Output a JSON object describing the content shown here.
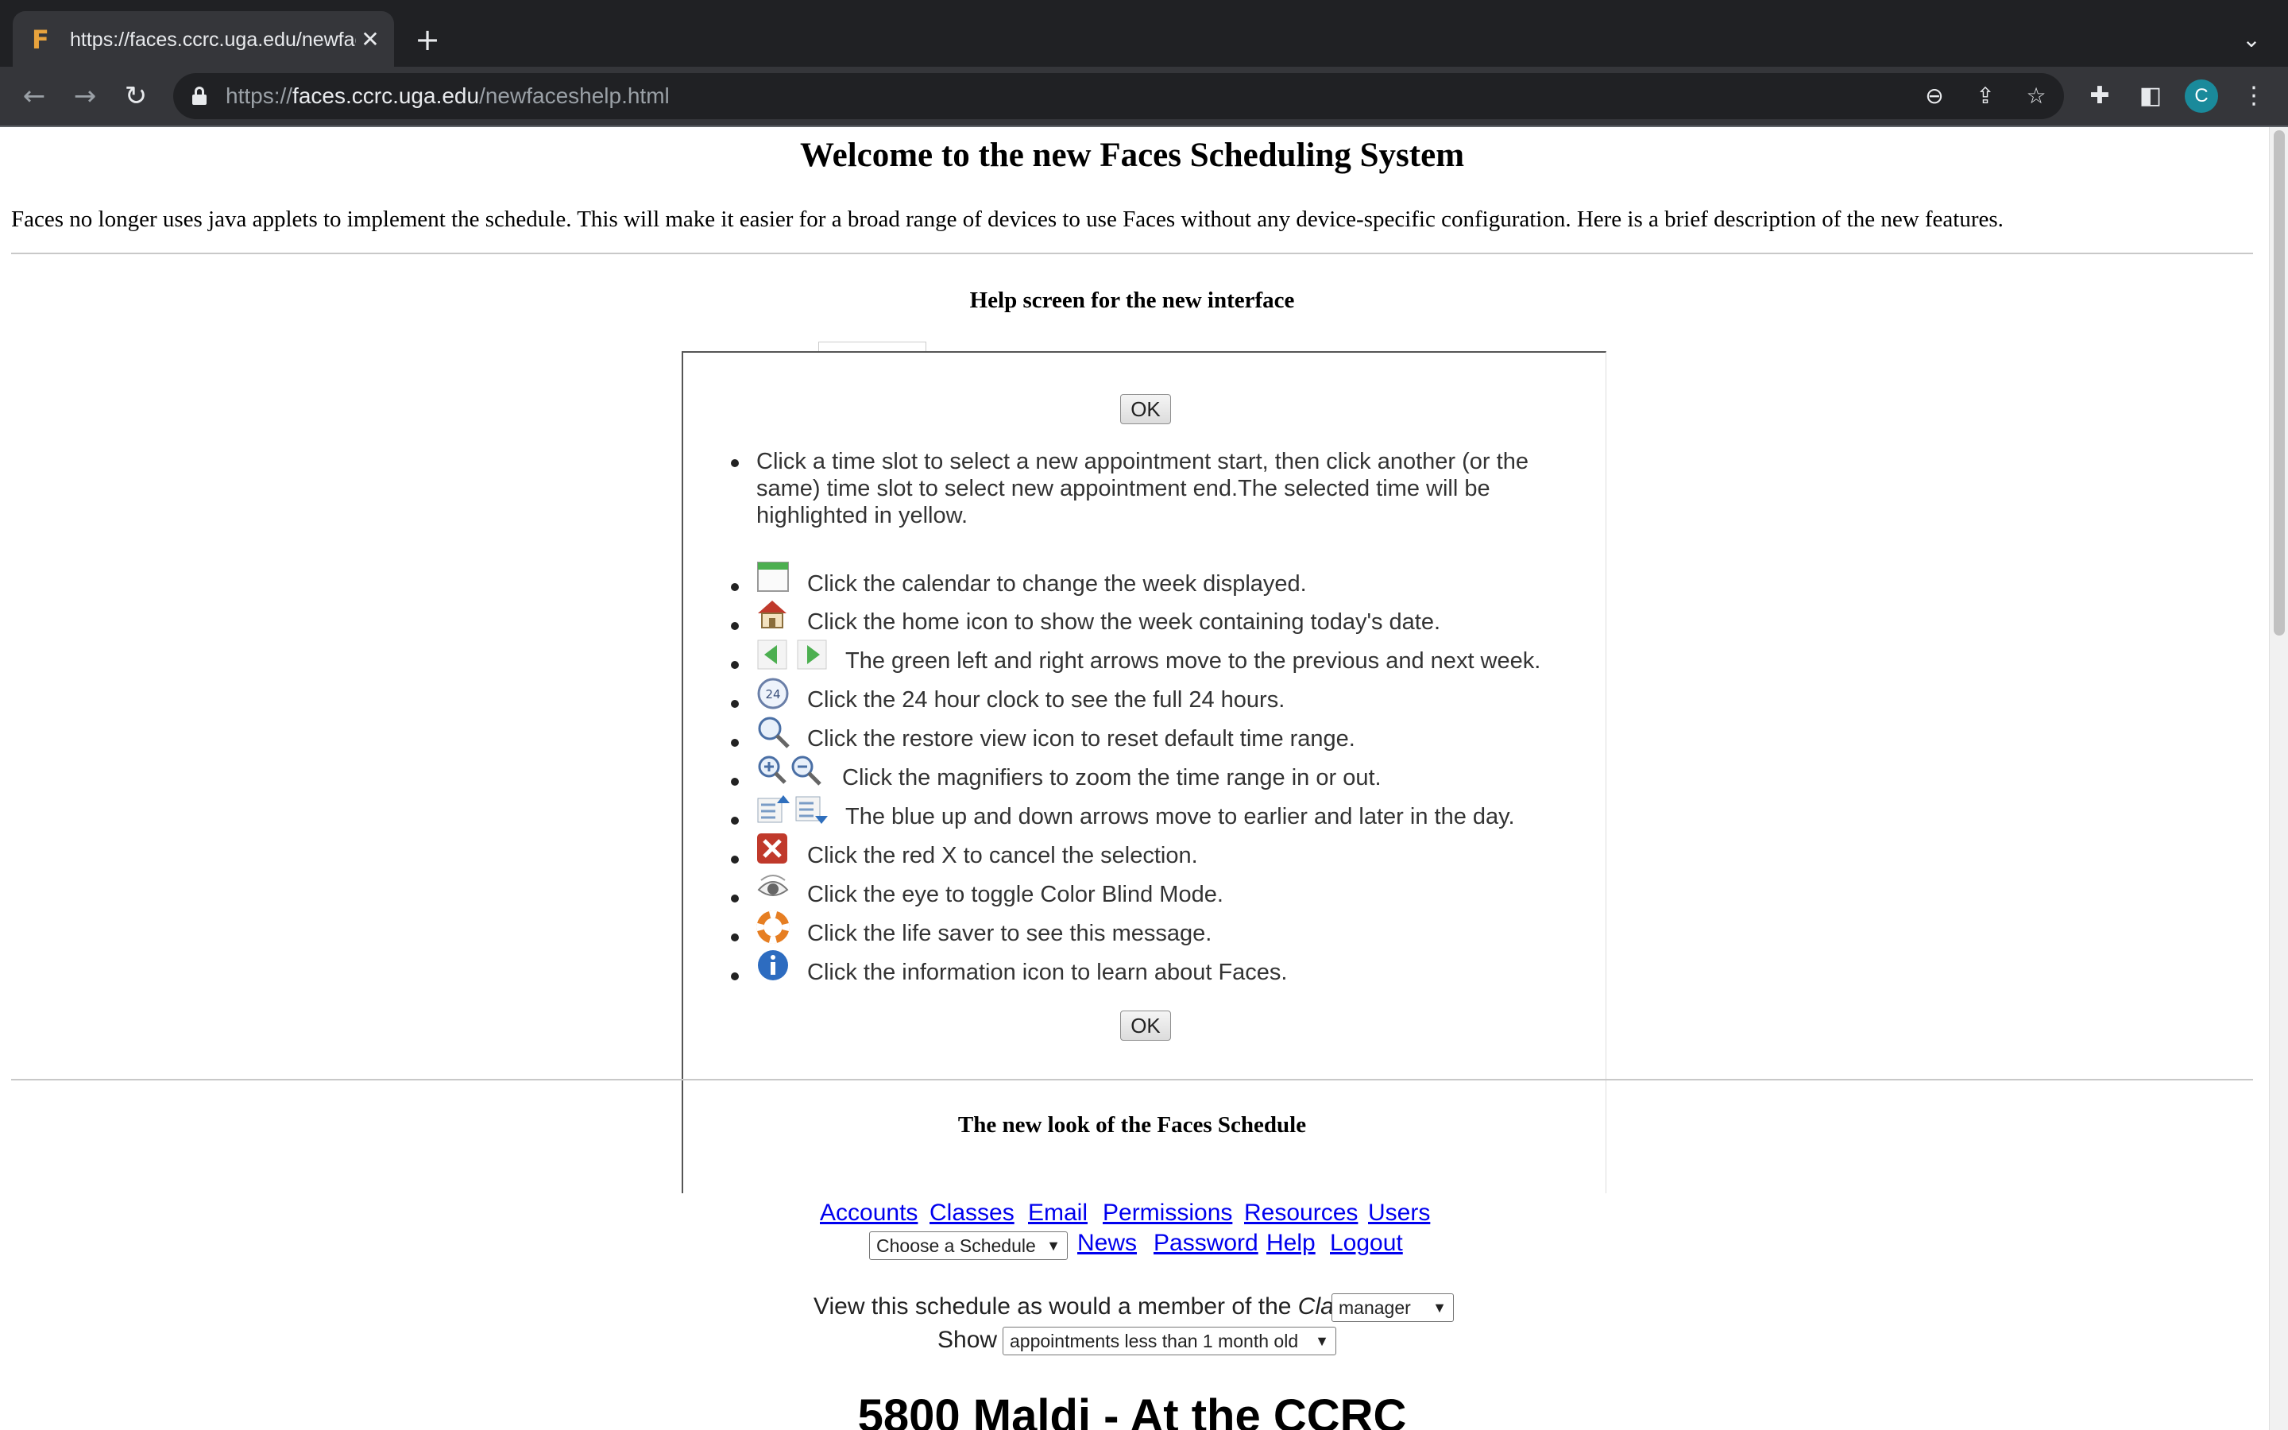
{
  "browser": {
    "tab_title": "https://faces.ccrc.uga.edu/newfaceshelp.html",
    "favicon_letter": "F",
    "url_scheme": "https://",
    "url_host": "faces.ccrc.uga.edu",
    "url_path": "/newfaceshelp.html",
    "profile_initial": "C"
  },
  "page": {
    "title": "Welcome to the new Faces Scheduling System",
    "intro": "Faces no longer uses java applets to implement the schedule. This will make it easier for a broad range of devices to use Faces without any device-specific configuration. Here is a brief description of the new features.",
    "help_heading": "Help screen for the new interface",
    "ok_label": "OK",
    "help_intro": "Click a time slot to select a new appointment start, then click another (or the same) time slot to select new appointment end.The selected time will be highlighted in yellow.",
    "help_items": [
      {
        "icon": "calendar-icon",
        "text": "Click the calendar to change the week displayed."
      },
      {
        "icon": "home-icon",
        "text": "Click the home icon to show the week containing today's date."
      },
      {
        "icon": "green-arrows-icon",
        "text": "The green left and right arrows move to the previous and next week."
      },
      {
        "icon": "clock-24-icon",
        "text": "Click the 24 hour clock to see the full 24 hours."
      },
      {
        "icon": "restore-view-icon",
        "text": "Click the restore view icon to reset default time range."
      },
      {
        "icon": "magnifier-icons",
        "text": "Click the magnifiers to zoom the time range in or out."
      },
      {
        "icon": "blue-arrows-icon",
        "text": "The blue up and down arrows move to earlier and later in the day."
      },
      {
        "icon": "red-x-icon",
        "text": "Click the red X to cancel the selection."
      },
      {
        "icon": "eye-icon",
        "text": "Click the eye to toggle Color Blind Mode."
      },
      {
        "icon": "life-saver-icon",
        "text": "Click the life saver to see this message."
      },
      {
        "icon": "info-icon",
        "text": "Click the information icon to learn about Faces."
      }
    ],
    "schedule_heading": "The new look of the Faces Schedule",
    "nav_links_row1": [
      "Accounts",
      "Classes",
      "Email",
      "Permissions",
      "Resources",
      "Users"
    ],
    "schedule_select": "Choose a Schedule",
    "nav_links_row2": [
      "News",
      "Password",
      "Help",
      "Logout"
    ],
    "view_as_prefix": "View this schedule as would a member of the",
    "view_as_class_word": "Class",
    "class_select": "manager",
    "show_label": "Show",
    "show_select": "appointments less than 1 month old",
    "schedule_title": "5800 Maldi - At the CCRC"
  }
}
